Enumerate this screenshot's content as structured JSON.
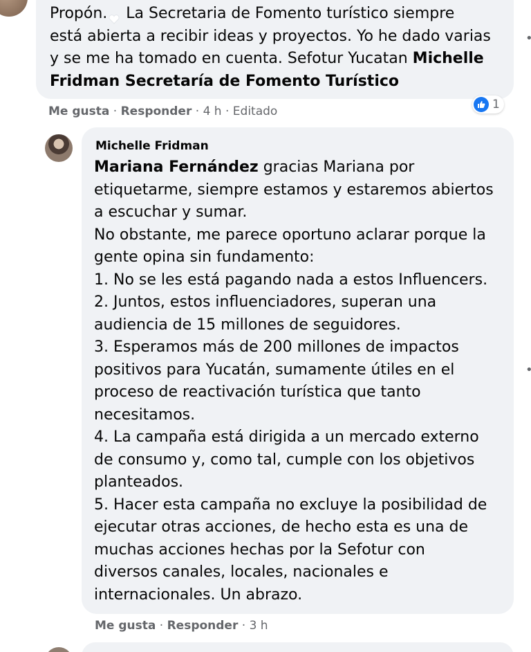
{
  "top_comment": {
    "text_line1_before_heart": "Propón.",
    "text_line1_after_heart": " La Secretaria de Fomento turístico siempre",
    "text_line2": "está abierta a recibir ideas y proyectos. Yo he dado varias",
    "text_line3": "y se me ha tomado en cuenta. Sefotur Yucatan ",
    "tag_mention": "Michelle Fridman Secretaría de Fomento Turístico",
    "reaction_count": "1",
    "like_label": "Me gusta",
    "reply_label": "Responder",
    "time": "4 h",
    "edited": "Editado",
    "separator": " · "
  },
  "reply_comment": {
    "author": "Michelle Fridman",
    "mention": "Mariana Fernández",
    "lines": [
      " gracias Mariana por",
      "etiquetarme, siempre estamos y estaremos abiertos",
      "a escuchar y sumar.",
      "No obstante, me parece oportuno aclarar porque la",
      "gente opina sin fundamento:",
      "1. No se les está pagando nada a estos Influencers.",
      "2. Juntos, estos influenciadores, superan una",
      "audiencia de 15 millones de seguidores.",
      "3. Esperamos más de 200 millones de impactos",
      "positivos para Yucatán, sumamente útiles en el",
      "proceso de reactivación turística que tanto",
      "necesitamos.",
      "4. La campaña está dirigida a un mercado externo",
      "de consumo y, como tal, cumple con los objetivos",
      "planteados.",
      "5. Hacer esta campaña no excluye la posibilidad de",
      "ejecutar otras acciones, de hecho esta es una de",
      "muchas acciones hechas por la Sefotur con",
      "diversos canales, locales, nacionales e",
      "internacionales. Un abrazo."
    ],
    "like_label": "Me gusta",
    "reply_label": "Responder",
    "time": "3 h",
    "separator": " · "
  },
  "icons": {
    "like": "thumbs-up-icon",
    "heart": "heart-icon",
    "more": "more-options-icon"
  },
  "colors": {
    "bubble": "#f0f2f5",
    "like_blue": "#1877f2",
    "meta_gray": "#65676b"
  }
}
